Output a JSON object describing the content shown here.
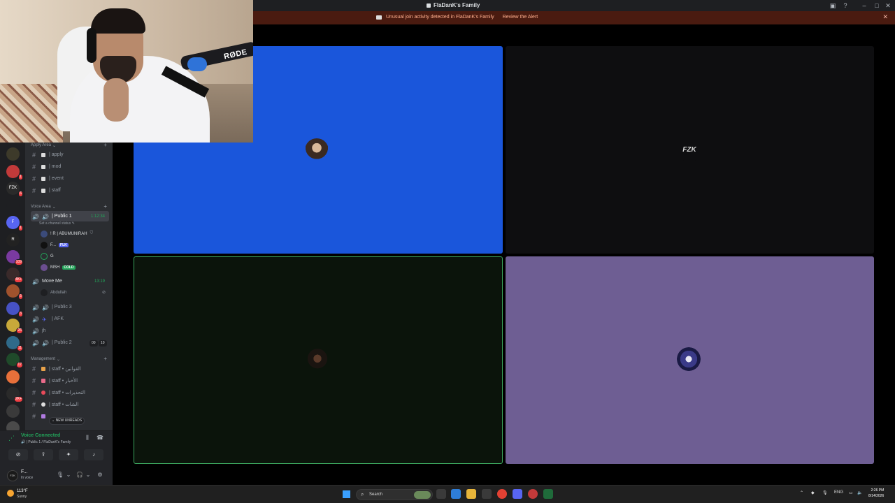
{
  "window": {
    "title": "FlaDanK's Family"
  },
  "alert": {
    "message": "Unusual join activity detected in FlaDanK's Family",
    "action": "Review the Alert"
  },
  "webcam": {
    "mic_brand": "RØDE"
  },
  "servers": [
    {
      "label": "",
      "badge": ""
    },
    {
      "label": "",
      "badge": "1"
    },
    {
      "label": "FZK",
      "badge": "6"
    },
    {
      "label": "",
      "badge": ""
    },
    {
      "label": "F",
      "badge": "1"
    },
    {
      "label": "R",
      "badge": ""
    },
    {
      "label": "",
      "badge": "109"
    },
    {
      "label": "",
      "badge": "4K+"
    },
    {
      "label": "",
      "badge": "5"
    },
    {
      "label": "",
      "badge": "3"
    },
    {
      "label": "",
      "badge": "26"
    },
    {
      "label": "",
      "badge": "11"
    },
    {
      "label": "",
      "badge": "17"
    },
    {
      "label": "",
      "badge": ""
    },
    {
      "label": "",
      "badge": "2K+"
    },
    {
      "label": "",
      "badge": ""
    },
    {
      "label": "",
      "badge": ""
    },
    {
      "label": "+",
      "badge": ""
    }
  ],
  "sidebar": {
    "apply_area": {
      "label": "Apply Area",
      "channels": [
        "| apply",
        "| mod",
        "| event",
        "| staff"
      ]
    },
    "voice_area": {
      "label": "Voice Area",
      "public1": {
        "name": "| Public 1",
        "time": "1:12:34",
        "status": "Set a channel status"
      },
      "users": [
        {
          "name": "! R | ABUMUNIRAH",
          "tag": ""
        },
        {
          "name": "F...",
          "tag": "FLK"
        },
        {
          "name": "G",
          "tag": ""
        },
        {
          "name": "MSH",
          "tag": "COLD"
        }
      ],
      "move_me": {
        "name": "Move Me",
        "time": "13:19",
        "user": "Abdullah"
      },
      "others": [
        {
          "name": "| Public 3"
        },
        {
          "name": "| AFK"
        },
        {
          "name": "jh"
        },
        {
          "name": "| Public 2",
          "c1": "00",
          "c2": "10"
        }
      ]
    },
    "management": {
      "label": "Management",
      "channels": [
        "| staff • القوانين",
        "| staff • الأخبار",
        "| staff • التحذيرات",
        "| staff • الشات"
      ],
      "new_unreads": "NEW UNREADS"
    }
  },
  "voice": {
    "status": "Voice Connected",
    "location": "| Public 1 / FlaDanK's Family"
  },
  "user": {
    "name": "F...",
    "status": "In voice",
    "avatar_text": "FZK"
  },
  "tiles": {
    "t2_text": "FZK"
  },
  "taskbar": {
    "temp": "113°F",
    "condition": "Sunny",
    "search": "Search",
    "lang": "ENG",
    "time": "2:26 PM",
    "date": "8/14/2026"
  },
  "colors": {
    "accent_voice": "#23a55a",
    "alert_bg": "#4a1b10",
    "tile1": "#1a56db",
    "tile4": "#6e5e93"
  }
}
